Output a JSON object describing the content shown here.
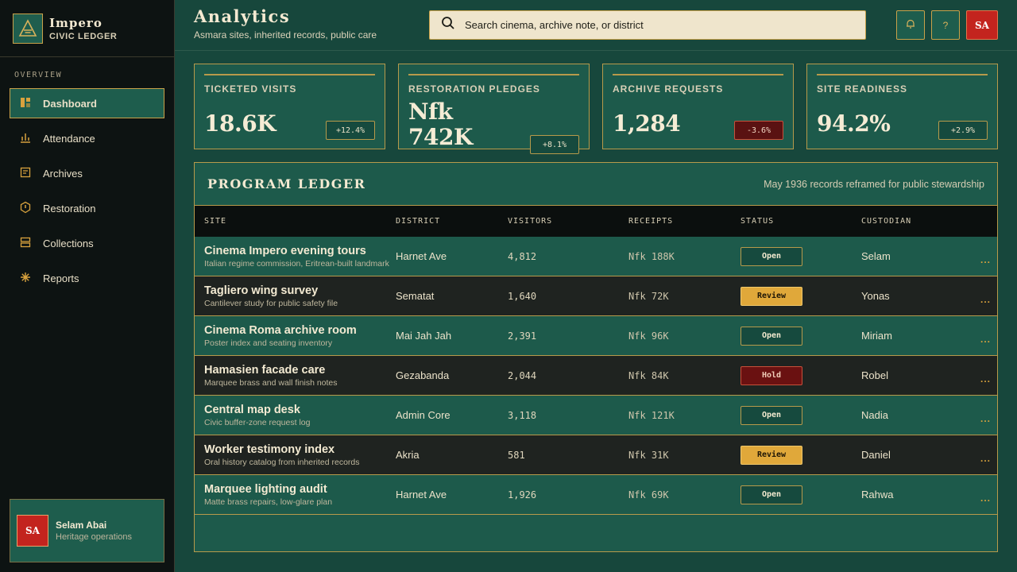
{
  "brand": {
    "title": "Impero",
    "subtitle": "CIVIC LEDGER"
  },
  "sidebar": {
    "section": "OVERVIEW",
    "items": [
      {
        "label": "Dashboard",
        "icon": "dashboard-icon",
        "active": true
      },
      {
        "label": "Attendance",
        "icon": "bar-chart-icon"
      },
      {
        "label": "Archives",
        "icon": "archive-icon"
      },
      {
        "label": "Restoration",
        "icon": "shield-icon"
      },
      {
        "label": "Collections",
        "icon": "collections-icon"
      },
      {
        "label": "Reports",
        "icon": "asterisk-icon"
      }
    ],
    "user": {
      "initials": "SA",
      "name": "Selam Abai",
      "role": "Heritage operations"
    }
  },
  "header": {
    "title": "Analytics",
    "subtitle": "Asmara sites, inherited records, public care",
    "search_placeholder": "Search cinema, archive note, or district",
    "help_label": "?",
    "profile_initials": "SA"
  },
  "kpis": [
    {
      "label": "TICKETED VISITS",
      "value": "18.6K",
      "delta": "+12.4%",
      "trend": "up"
    },
    {
      "label": "RESTORATION PLEDGES",
      "value": "Nfk 742K",
      "delta": "+8.1%",
      "trend": "up"
    },
    {
      "label": "ARCHIVE REQUESTS",
      "value": "1,284",
      "delta": "-3.6%",
      "trend": "down"
    },
    {
      "label": "SITE READINESS",
      "value": "94.2%",
      "delta": "+2.9%",
      "trend": "up"
    }
  ],
  "ledger": {
    "title": "PROGRAM LEDGER",
    "note": "May 1936 records reframed for public stewardship",
    "columns": [
      "SITE",
      "DISTRICT",
      "VISITORS",
      "RECEIPTS",
      "STATUS",
      "CUSTODIAN"
    ],
    "rows": [
      {
        "site": "Cinema Impero evening tours",
        "note": "Italian regime commission, Eritrean-built landmark",
        "district": "Harnet Ave",
        "visitors": "4,812",
        "receipts": "Nfk 188K",
        "status": "Open",
        "custodian": "Selam"
      },
      {
        "site": "Tagliero wing survey",
        "note": "Cantilever study for public safety file",
        "district": "Sematat",
        "visitors": "1,640",
        "receipts": "Nfk 72K",
        "status": "Review",
        "custodian": "Yonas"
      },
      {
        "site": "Cinema Roma archive room",
        "note": "Poster index and seating inventory",
        "district": "Mai Jah Jah",
        "visitors": "2,391",
        "receipts": "Nfk 96K",
        "status": "Open",
        "custodian": "Miriam"
      },
      {
        "site": "Hamasien facade care",
        "note": "Marquee brass and wall finish notes",
        "district": "Gezabanda",
        "visitors": "2,044",
        "receipts": "Nfk 84K",
        "status": "Hold",
        "custodian": "Robel"
      },
      {
        "site": "Central map desk",
        "note": "Civic buffer-zone request log",
        "district": "Admin Core",
        "visitors": "3,118",
        "receipts": "Nfk 121K",
        "status": "Open",
        "custodian": "Nadia"
      },
      {
        "site": "Worker testimony index",
        "note": "Oral history catalog from inherited records",
        "district": "Akria",
        "visitors": "581",
        "receipts": "Nfk 31K",
        "status": "Review",
        "custodian": "Daniel"
      },
      {
        "site": "Marquee lighting audit",
        "note": "Matte brass repairs, low-glare plan",
        "district": "Harnet Ave",
        "visitors": "1,926",
        "receipts": "Nfk 69K",
        "status": "Open",
        "custodian": "Rahwa"
      }
    ],
    "row_menu_label": "..."
  }
}
